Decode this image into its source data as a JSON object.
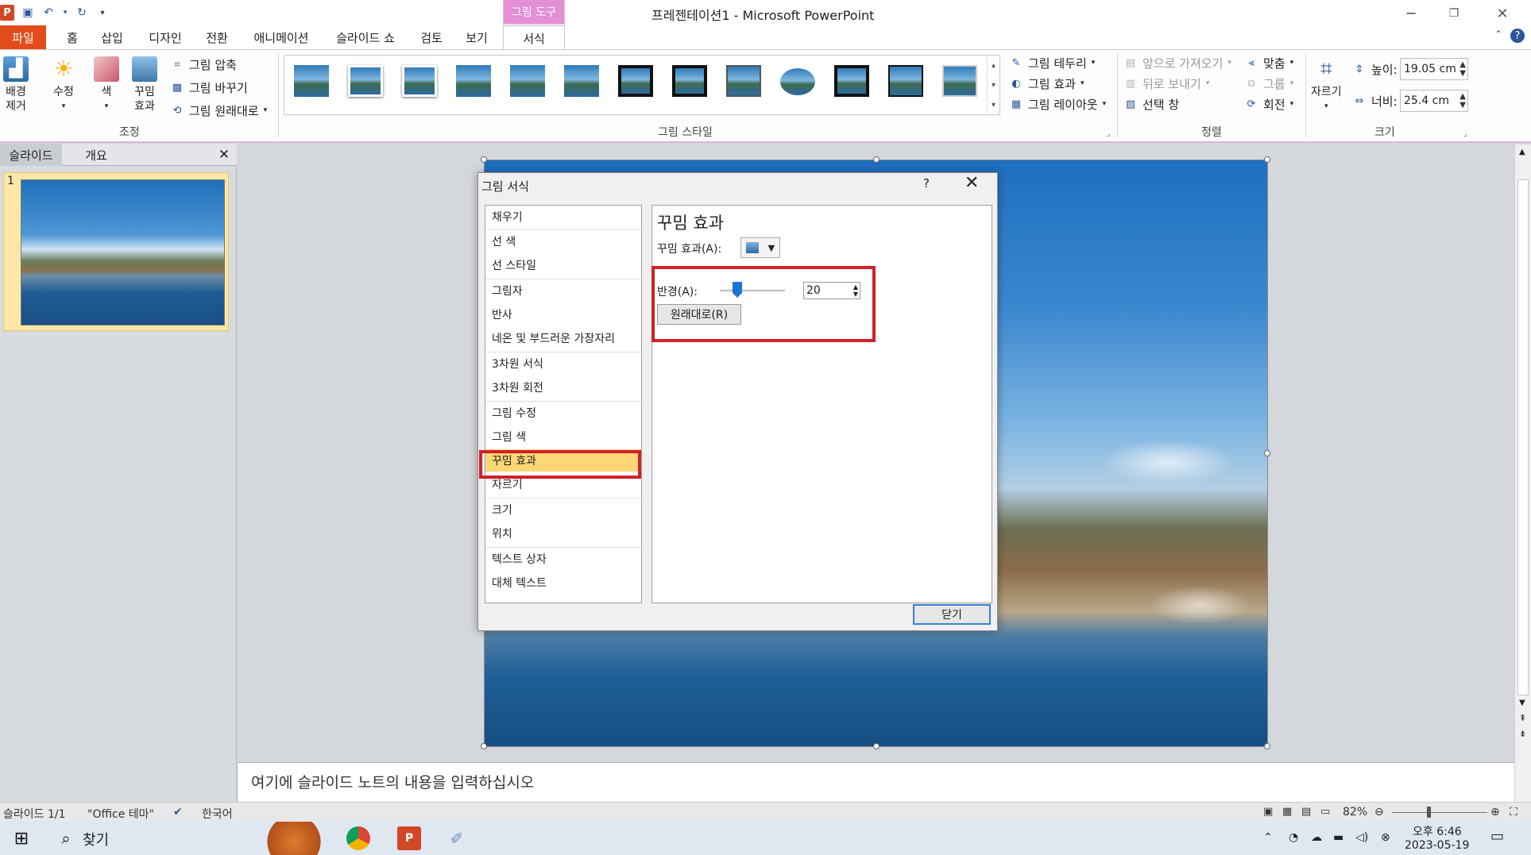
{
  "app": {
    "title": "프레젠테이션1 - Microsoft PowerPoint",
    "logo": "P"
  },
  "qat": {
    "save_icon": "save-icon",
    "undo_icon": "undo-icon",
    "redo_icon": "redo-icon",
    "customize_icon": "customize-icon"
  },
  "contextual_tab": {
    "header": "그림 도구",
    "tab": "서식"
  },
  "tabs": [
    "파일",
    "홈",
    "삽입",
    "디자인",
    "전환",
    "애니메이션",
    "슬라이드 쇼",
    "검토",
    "보기"
  ],
  "ribbon": {
    "adjust": {
      "remove_bg": [
        "배경",
        "제거"
      ],
      "corrections": "수정",
      "color": "색",
      "artistic": [
        "꾸밈",
        "효과"
      ],
      "compress": "그림 압축",
      "change": "그림 바꾸기",
      "reset": "그림 원래대로",
      "label": "조정"
    },
    "styles": {
      "label": "그림 스타일",
      "border": "그림 테두리",
      "effects": "그림 효과",
      "layout": "그림 레이아웃"
    },
    "arrange": {
      "label": "정렬",
      "bring_forward": "앞으로 가져오기",
      "send_backward": "뒤로 보내기",
      "selection_pane": "선택 창",
      "align": "맞춤",
      "group": "그룹",
      "rotate": "회전"
    },
    "size": {
      "label": "크기",
      "crop": "자르기",
      "height_label": "높이:",
      "height_value": "19.05 cm",
      "width_label": "너비:",
      "width_value": "25.4 cm"
    }
  },
  "panel": {
    "tab_slides": "슬라이드",
    "tab_outline": "개요",
    "slide_number": "1"
  },
  "dialog": {
    "title": "그림 서식",
    "help": "?",
    "nav": [
      "채우기",
      "선 색",
      "선 스타일",
      "그림자",
      "반사",
      "네온 및 부드러운 가장자리",
      "3차원 서식",
      "3차원 회전",
      "그림 수정",
      "그림 색",
      "꾸밈 효과",
      "자르기",
      "크기",
      "위치",
      "텍스트 상자",
      "대체 텍스트"
    ],
    "selected_index": 10,
    "content_title": "꾸밈 효과",
    "effect_label": "꾸밈 효과(A):",
    "radius_label": "반경(A):",
    "radius_value": "20",
    "reset_button": "원래대로(R)",
    "close_button": "닫기"
  },
  "notes": {
    "placeholder": "여기에 슬라이드 노트의 내용을 입력하십시오"
  },
  "statusbar": {
    "slide_info": "슬라이드 1/1",
    "theme": "\"Office 테마\"",
    "language": "한국어",
    "zoom": "82%"
  },
  "taskbar": {
    "search": "찾기",
    "time": "오후 6:46",
    "date": "2023-05-19"
  },
  "colors": {
    "file_tab": "#e24c1b",
    "contextual": "#e48fd6",
    "highlight": "#d1202a",
    "selected_nav": "#fdd775"
  }
}
